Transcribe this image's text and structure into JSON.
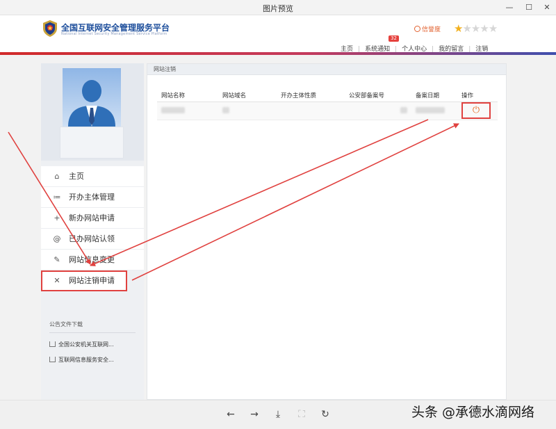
{
  "window": {
    "title": "图片预览",
    "controls": {
      "minimize": "—",
      "maximize": "☐",
      "close": "✕"
    }
  },
  "site": {
    "title": "全国互联网安全管理服务平台",
    "subtitle": "National Internet Security Management Service Platform",
    "credit_label": "信誉度",
    "rating": {
      "filled": 1,
      "total": 5
    },
    "nav": [
      {
        "label": "主页"
      },
      {
        "label": "系统通知",
        "badge": "32"
      },
      {
        "label": "个人中心"
      },
      {
        "label": "我的留言"
      },
      {
        "label": "注销"
      }
    ]
  },
  "sidebar": {
    "menu": [
      {
        "icon": "home-icon",
        "glyph": "⌂",
        "label": "主页"
      },
      {
        "icon": "list-icon",
        "glyph": "≔",
        "label": "开办主体管理"
      },
      {
        "icon": "plus-icon",
        "glyph": "+",
        "label": "新办网站申请"
      },
      {
        "icon": "at-icon",
        "glyph": "@",
        "label": "已办网站认领"
      },
      {
        "icon": "edit-icon",
        "glyph": "✎",
        "label": "网站信息变更"
      },
      {
        "icon": "close-icon",
        "glyph": "✕",
        "label": "网站注销申请"
      }
    ],
    "files_title": "公告文件下载",
    "files": [
      {
        "label": "全国公安机关互联网..."
      },
      {
        "label": "互联网信息服务安全..."
      }
    ]
  },
  "panel": {
    "title": "网站注销",
    "columns": [
      "网站名称",
      "网站域名",
      "开办主体性质",
      "公安部备案号",
      "备案日期",
      "操作"
    ],
    "action_icon": "power-icon"
  },
  "toolbar": {
    "buttons": [
      {
        "name": "prev-button",
        "glyph": "←"
      },
      {
        "name": "next-button",
        "glyph": "→"
      },
      {
        "name": "download-button",
        "glyph": "⤓"
      },
      {
        "name": "fit-button",
        "glyph": "⛶"
      },
      {
        "name": "rotate-button",
        "glyph": "↻"
      }
    ]
  },
  "watermark": "头条 @承德水滴网络",
  "colors": {
    "accent_red": "#e0413f",
    "brand_blue": "#1e4f9c",
    "credit_orange": "#e2612f",
    "star_gold": "#f2b01e"
  }
}
